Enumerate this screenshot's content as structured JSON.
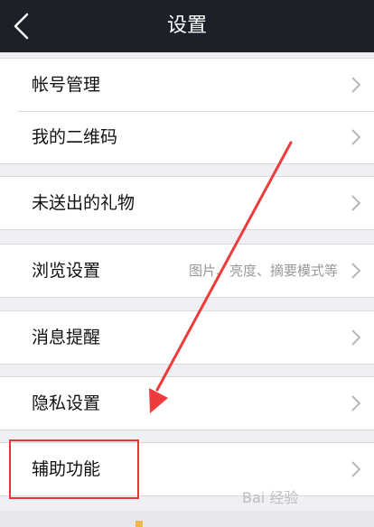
{
  "header": {
    "title": "设置",
    "back_icon": "chevron-left-icon"
  },
  "groups": [
    {
      "rows": [
        {
          "label": "帐号管理",
          "detail": ""
        },
        {
          "label": "我的二维码",
          "detail": ""
        }
      ]
    },
    {
      "rows": [
        {
          "label": "未送出的礼物",
          "detail": ""
        }
      ]
    },
    {
      "rows": [
        {
          "label": "浏览设置",
          "detail": "图片、亮度、摘要模式等"
        }
      ]
    },
    {
      "rows": [
        {
          "label": "消息提醒",
          "detail": ""
        }
      ]
    },
    {
      "rows": [
        {
          "label": "隐私设置",
          "detail": ""
        }
      ]
    },
    {
      "rows": [
        {
          "label": "辅助功能",
          "detail": ""
        }
      ]
    }
  ],
  "row_icon": "chevron-right-icon",
  "annotation": {
    "color": "#e53535",
    "highlighted_label": "辅助功能"
  },
  "watermark": "Bai 经验",
  "colors": {
    "header_bg": "#1c2129",
    "page_bg": "#f0eff4"
  }
}
